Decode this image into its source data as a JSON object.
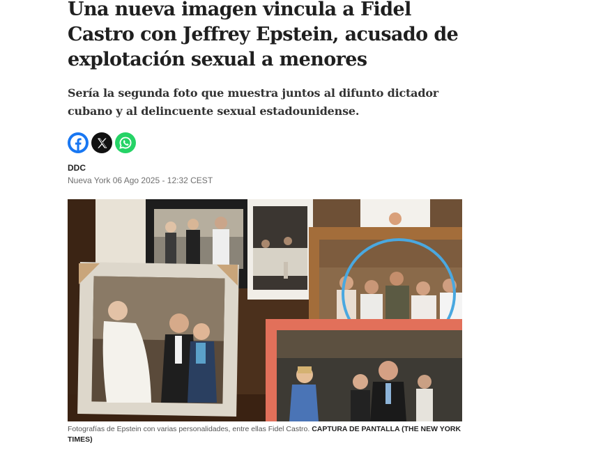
{
  "article": {
    "headline": "Una nueva imagen vincula a Fidel Castro con Jeffrey Epstein, acusado de explotación sexual a menores",
    "deck": "Sería la segunda foto que muestra juntos al difunto dictador cubano y al delincuente sexual estadounidense.",
    "author": "DDC",
    "dateline": "Nueva York 06 Ago 2025 - 12:32 CEST"
  },
  "share": {
    "facebook_icon": "facebook-icon",
    "x_icon": "x-icon",
    "whatsapp_icon": "whatsapp-icon",
    "colors": {
      "facebook": "#1877f2",
      "x": "#111111",
      "whatsapp": "#25d366"
    }
  },
  "figure": {
    "caption_text": "Fotografías de Epstein con varias personalidades, entre ellas Fidel Castro. ",
    "caption_credit": "CAPTURA DE PANTALLA (THE NEW YORK TIMES)",
    "highlight_color": "#4aa8e0"
  }
}
